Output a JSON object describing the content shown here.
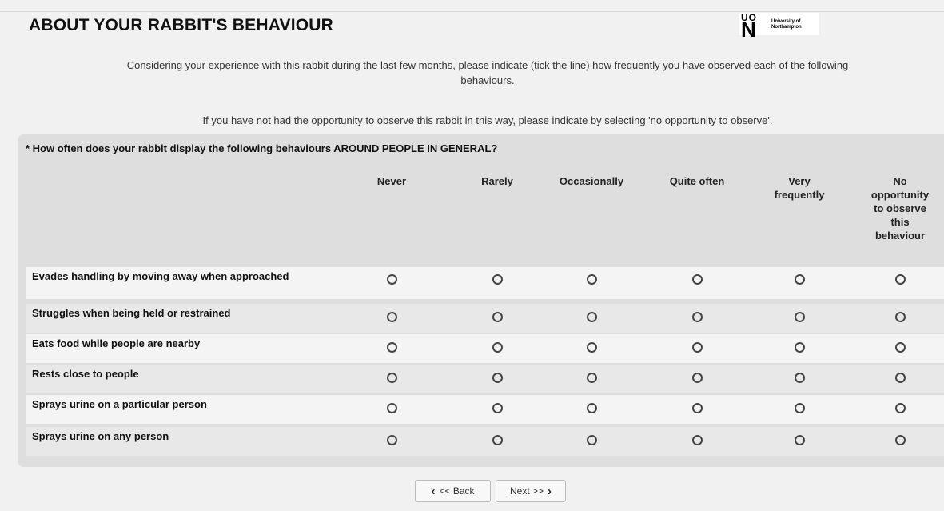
{
  "page": {
    "title": "ABOUT YOUR RABBIT'S BEHAVIOUR",
    "logo": {
      "mark_top": "UO",
      "mark_bottom": "N",
      "text_line1": "University of",
      "text_line2": "Northampton"
    },
    "intro_line1": "Considering your experience with this rabbit during the last few months, please indicate (tick the line) how frequently you have observed each of the following",
    "intro_line1b": "behaviours.",
    "intro_line2": "If you have not had the opportunity to observe this rabbit in this way, please indicate by selecting 'no opportunity to observe'."
  },
  "question": {
    "text": "* How often does your rabbit display the following behaviours AROUND PEOPLE IN GENERAL?",
    "columns": [
      "Never",
      "Rarely",
      "Occasionally",
      "Quite often",
      "Very frequently",
      "No opportunity to observe this behaviour"
    ],
    "rows": [
      "Evades handling by moving away when approached",
      "Struggles when being held or restrained",
      "Eats food while people are nearby",
      "Rests close to people",
      "Sprays urine on a particular person",
      "Sprays urine on any person"
    ],
    "selected": [
      null,
      null,
      null,
      null,
      null,
      null
    ]
  },
  "nav": {
    "back_label": "<< Back",
    "next_label": "Next >>",
    "back_icon": "chevron-left-icon",
    "next_icon": "chevron-right-icon"
  }
}
